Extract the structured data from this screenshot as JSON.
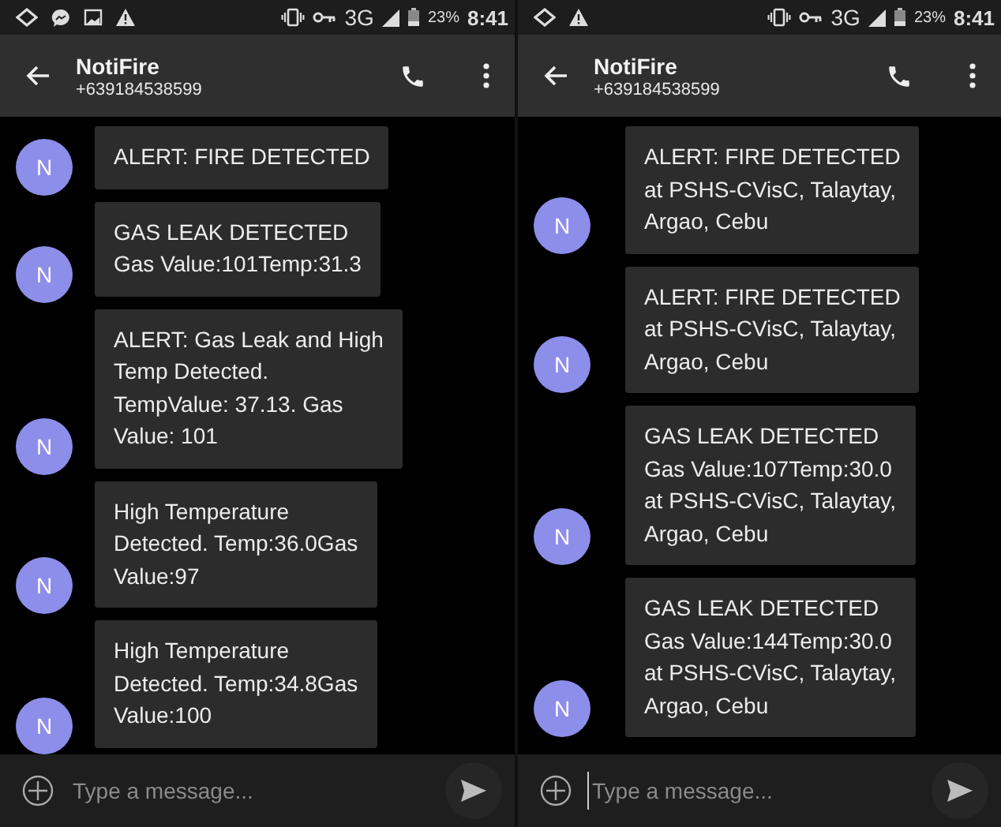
{
  "screens": [
    {
      "status_bar": {
        "network": "3G",
        "battery": "23%",
        "time": "8:41"
      },
      "header": {
        "title": "NotiFire",
        "subtitle": "+639184538599"
      },
      "messages": [
        {
          "avatar": "N",
          "lines": [
            "ALERT: FIRE DETECTED"
          ]
        },
        {
          "avatar": "N",
          "lines": [
            "GAS LEAK DETECTED",
            "Gas Value:101Temp:31.3"
          ]
        },
        {
          "avatar": "N",
          "lines": [
            "ALERT: Gas Leak and High",
            "Temp Detected.",
            "TempValue: 37.13. Gas",
            "Value: 101"
          ]
        },
        {
          "avatar": "N",
          "lines": [
            "High Temperature",
            "Detected. Temp:36.0Gas",
            "Value:97"
          ]
        },
        {
          "avatar": "N",
          "lines": [
            "High Temperature",
            "Detected. Temp:34.8Gas",
            "Value:100"
          ]
        }
      ],
      "composer": {
        "placeholder": "Type a message...",
        "focused": false
      }
    },
    {
      "status_bar": {
        "network": "3G",
        "battery": "23%",
        "time": "8:41"
      },
      "header": {
        "title": "NotiFire",
        "subtitle": "+639184538599"
      },
      "messages": [
        {
          "avatar": "N",
          "lines": [
            "ALERT: FIRE DETECTED",
            "at PSHS-CVisC, Talaytay,",
            "Argao, Cebu"
          ]
        },
        {
          "avatar": "N",
          "lines": [
            "ALERT: FIRE DETECTED",
            "at PSHS-CVisC, Talaytay,",
            "Argao, Cebu"
          ]
        },
        {
          "avatar": "N",
          "lines": [
            "GAS LEAK DETECTED",
            "Gas Value:107Temp:30.0",
            "at PSHS-CVisC, Talaytay,",
            "Argao, Cebu"
          ]
        },
        {
          "avatar": "N",
          "lines": [
            "GAS LEAK DETECTED",
            "Gas Value:144Temp:30.0",
            "at PSHS-CVisC, Talaytay,",
            "Argao, Cebu"
          ]
        }
      ],
      "composer": {
        "placeholder": "Type a message...",
        "focused": true
      }
    }
  ]
}
